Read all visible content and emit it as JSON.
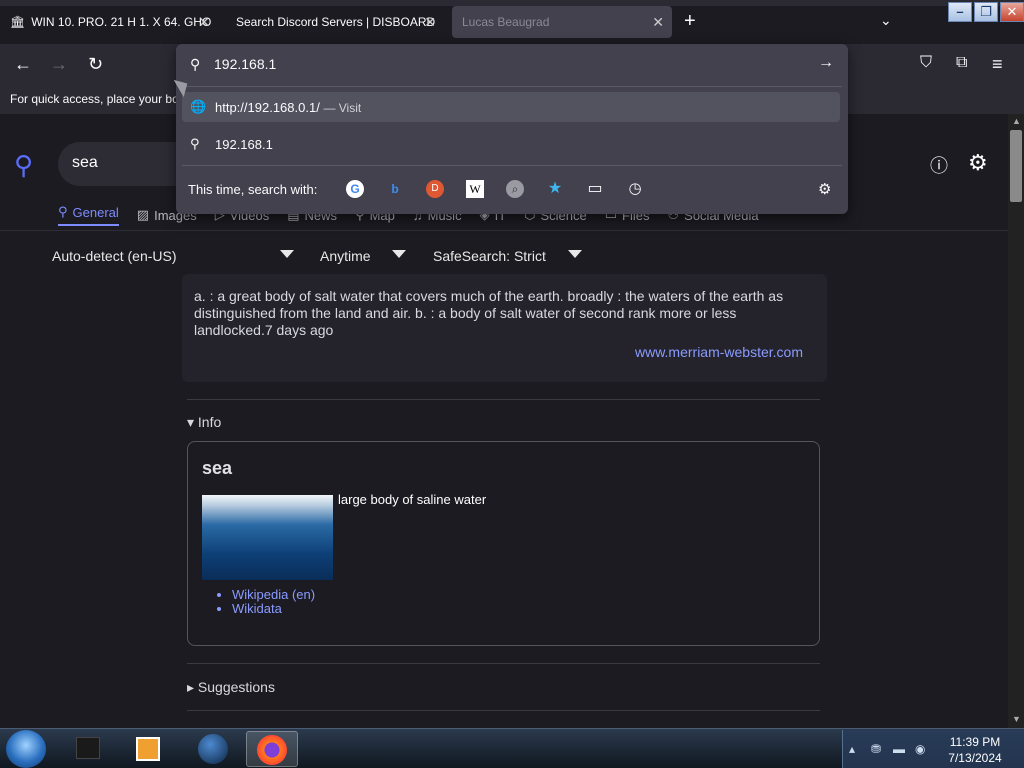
{
  "tabs": [
    {
      "title": "WIN 10. PRO. 21 H 1. X 64. GHO"
    },
    {
      "title": "Search Discord Servers | DISBOARD"
    },
    {
      "title": "Lucas Beaugrad"
    }
  ],
  "toolbar": {
    "back": "←",
    "forward": "→",
    "reload": "↻",
    "pocket": "⛉",
    "extensions": "⧉",
    "menu": "≡"
  },
  "bookmarks_hint": "For quick access, place your bookmarks here on the bookmarks toolbar.",
  "url_dropdown": {
    "input_value": "192.168.1",
    "suggestions": [
      {
        "icon": "globe-icon",
        "text": "http://192.168.0.1/",
        "action": "— Visit"
      },
      {
        "icon": "search-icon",
        "text": "192.168.1",
        "action": ""
      }
    ],
    "search_with_label": "This time, search with:",
    "engines": [
      "G",
      "b",
      "D",
      "W",
      "⌕",
      "★",
      "▭",
      "◷"
    ]
  },
  "search": {
    "query": "sea",
    "categories": [
      "General",
      "Images",
      "Videos",
      "News",
      "Map",
      "Music",
      "IT",
      "Science",
      "Files",
      "Social Media"
    ],
    "active_category": "General",
    "filters": {
      "language": "Auto-detect (en-US)",
      "time": "Anytime",
      "safesearch": "SafeSearch: Strict"
    }
  },
  "answer": {
    "text": "a. : a great body of salt water that covers much of the earth. broadly : the waters of the earth as distinguished from the land and air. b. : a body of salt water of second rank more or less landlocked.7 days ago",
    "source": "www.merriam-webster.com"
  },
  "infobox": {
    "section": "▾ Info",
    "title": "sea",
    "description": "large body of saline water",
    "links": [
      "Wikipedia (en)",
      "Wikidata"
    ]
  },
  "suggestions_label": "▸ Suggestions",
  "taskbar": {
    "time": "11:39 PM",
    "date": "7/13/2024"
  },
  "colors": {
    "accent": "#7d8bff",
    "link": "#8a9bff",
    "panel": "#42414d",
    "bg": "#1c1b22"
  }
}
